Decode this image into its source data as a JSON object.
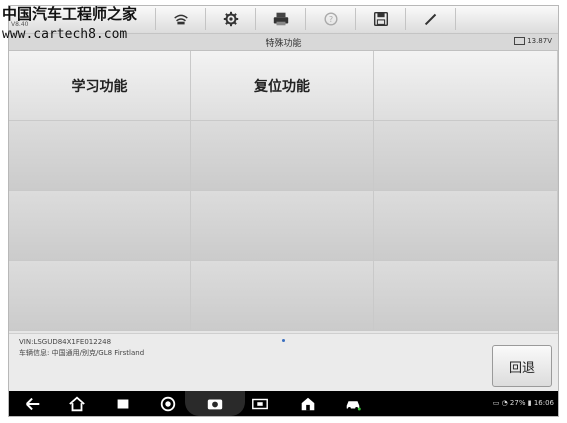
{
  "watermark": {
    "line1": "中国汽车工程师之家",
    "line2": "www.cartech8.com"
  },
  "version_label": "V8.40",
  "toolbar": {
    "buttons": [
      {
        "name": "vci-link-icon"
      },
      {
        "name": "settings-gear-icon"
      },
      {
        "name": "printer-icon"
      },
      {
        "name": "help-icon"
      },
      {
        "name": "save-icon"
      },
      {
        "name": "pen-icon"
      }
    ]
  },
  "header": {
    "title": "特殊功能",
    "battery_voltage": "13.87V"
  },
  "functions": {
    "cells": [
      "学习功能",
      "复位功能",
      "",
      "",
      "",
      "",
      "",
      "",
      "",
      "",
      "",
      ""
    ]
  },
  "vehicle_info": {
    "vin": "VIN:LSGUD84X1FE012248",
    "car": "车辆信息: 中国通用/别克/GL8 Firstland"
  },
  "back_button": {
    "label": "回退"
  },
  "system_bar": {
    "time": "16:06",
    "battery": "27%"
  },
  "colors": {
    "toolbar_bg": "#e0e0e0",
    "navbar_bg": "#000000",
    "page_dot": "#3a6fbf"
  }
}
